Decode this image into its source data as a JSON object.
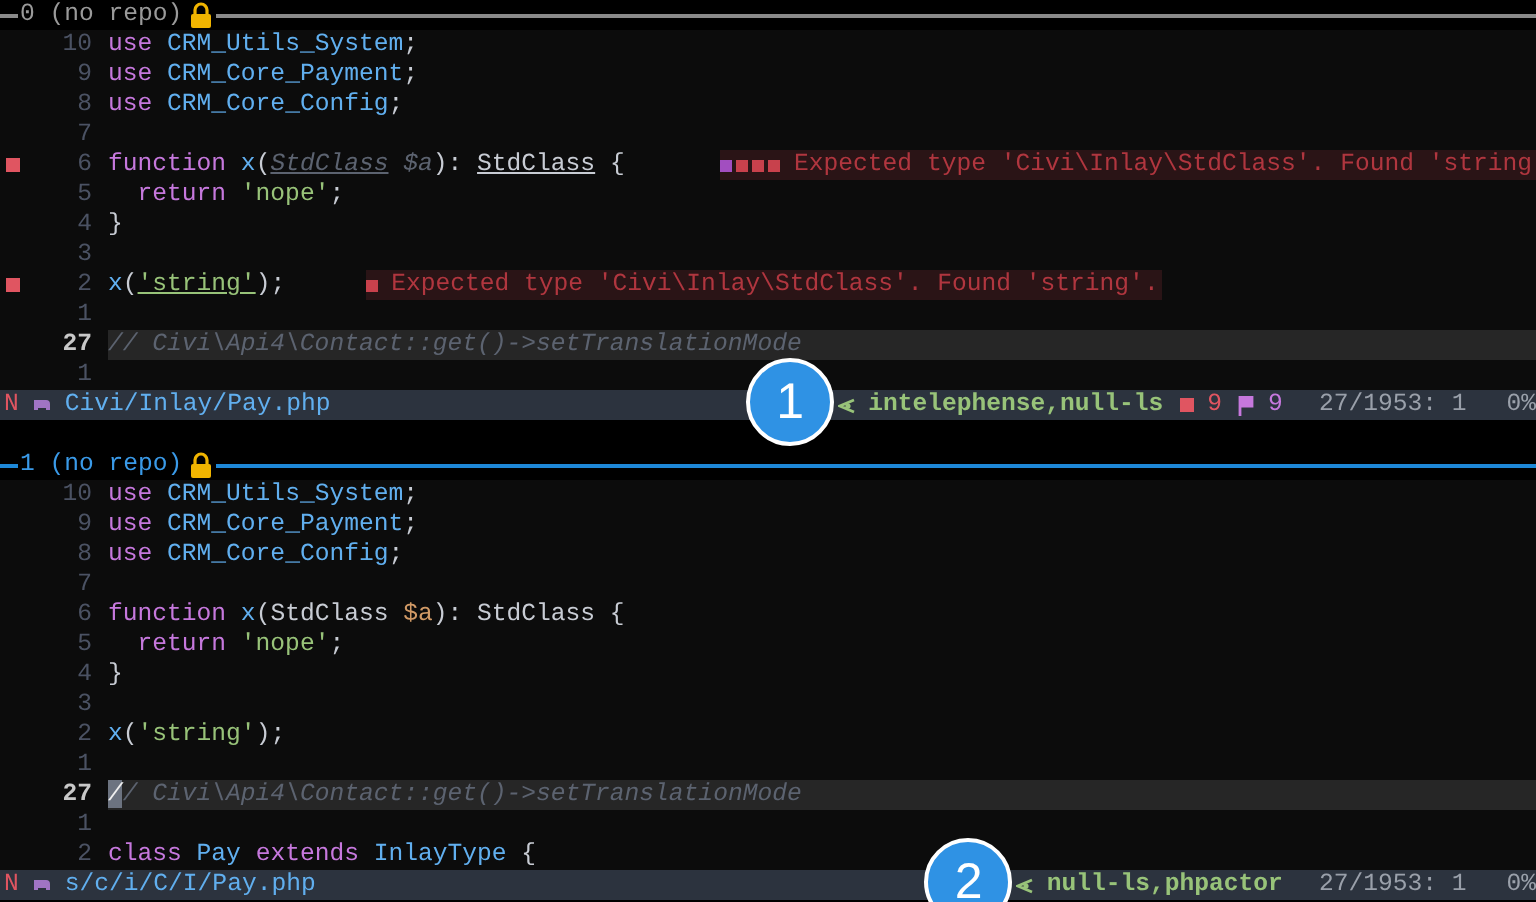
{
  "panes": [
    {
      "header": {
        "title": "0 (no repo)",
        "active": false
      },
      "lines": [
        {
          "number": "10",
          "current": false,
          "sign": false,
          "cursor": false,
          "tokens": [
            {
              "text": "use ",
              "kind": "keyword"
            },
            {
              "text": "CRM_Utils_System",
              "kind": "type"
            },
            {
              "text": ";",
              "kind": "plain"
            }
          ]
        },
        {
          "number": "9",
          "current": false,
          "sign": false,
          "cursor": false,
          "tokens": [
            {
              "text": "use ",
              "kind": "keyword"
            },
            {
              "text": "CRM_Core_Payment",
              "kind": "type"
            },
            {
              "text": ";",
              "kind": "plain"
            }
          ]
        },
        {
          "number": "8",
          "current": false,
          "sign": false,
          "cursor": false,
          "tokens": [
            {
              "text": "use ",
              "kind": "keyword"
            },
            {
              "text": "CRM_Core_Config",
              "kind": "type"
            },
            {
              "text": ";",
              "kind": "plain"
            }
          ]
        },
        {
          "number": "7",
          "current": false,
          "sign": false,
          "cursor": false
        },
        {
          "number": "6",
          "current": false,
          "sign": true,
          "cursor": false,
          "tokens": [
            {
              "text": "function ",
              "kind": "keyword"
            },
            {
              "text": "x",
              "kind": "type"
            },
            {
              "text": "(",
              "kind": "plain"
            },
            {
              "text": "StdClass",
              "kind": "unused-underlined"
            },
            {
              "text": " $a",
              "kind": "unused"
            },
            {
              "text": "): ",
              "kind": "plain"
            },
            {
              "text": "StdClass",
              "kind": "plain-underlined"
            },
            {
              "text": " {",
              "kind": "plain"
            }
          ],
          "diagnostic": {
            "marks": [
              {
                "color": "#a24ec0"
              },
              {
                "color": "#c8414c"
              },
              {
                "color": "#c8414c"
              },
              {
                "color": "#c8414c"
              }
            ],
            "text": "Expected type 'Civi\\Inlay\\StdClass'. Found 'string"
          }
        },
        {
          "number": "5",
          "current": false,
          "sign": false,
          "cursor": false,
          "tokens": [
            {
              "text": "  return ",
              "kind": "keyword"
            },
            {
              "text": "'nope'",
              "kind": "string"
            },
            {
              "text": ";",
              "kind": "plain"
            }
          ]
        },
        {
          "number": "4",
          "current": false,
          "sign": false,
          "cursor": false,
          "tokens": [
            {
              "text": "}",
              "kind": "plain"
            }
          ]
        },
        {
          "number": "3",
          "current": false,
          "sign": false,
          "cursor": false
        },
        {
          "number": "2",
          "current": false,
          "sign": true,
          "cursor": false,
          "tokens": [
            {
              "text": "x",
              "kind": "type"
            },
            {
              "text": "(",
              "kind": "plain"
            },
            {
              "text": "'string'",
              "kind": "string-underlined"
            },
            {
              "text": ");",
              "kind": "plain"
            }
          ],
          "diagnostic": {
            "marks": [
              {
                "color": "#c8414c"
              }
            ],
            "text": "Expected type 'Civi\\Inlay\\StdClass'. Found 'string'."
          }
        },
        {
          "number": "1",
          "current": false,
          "sign": false,
          "cursor": false
        },
        {
          "number": "27",
          "current": true,
          "sign": false,
          "cursor": false,
          "tokens": [
            {
              "text": "// Civi\\Api4\\Contact::get()->setTranslationMode",
              "kind": "comment"
            }
          ]
        },
        {
          "number": "1",
          "current": false,
          "sign": false,
          "cursor": false
        }
      ],
      "status": {
        "mode": "N",
        "file": "Civi/Inlay/Pay.php",
        "callout": "1",
        "lsp": "intelephense,null-ls",
        "errors": "9",
        "warnings": "9",
        "position": "27/1953: 1",
        "percent": "0%"
      }
    },
    {
      "header": {
        "title": "1 (no repo)",
        "active": true
      },
      "lines": [
        {
          "number": "10",
          "current": false,
          "sign": false,
          "cursor": false,
          "tokens": [
            {
              "text": "use ",
              "kind": "keyword"
            },
            {
              "text": "CRM_Utils_System",
              "kind": "type"
            },
            {
              "text": ";",
              "kind": "plain"
            }
          ]
        },
        {
          "number": "9",
          "current": false,
          "sign": false,
          "cursor": false,
          "tokens": [
            {
              "text": "use ",
              "kind": "keyword"
            },
            {
              "text": "CRM_Core_Payment",
              "kind": "type"
            },
            {
              "text": ";",
              "kind": "plain"
            }
          ]
        },
        {
          "number": "8",
          "current": false,
          "sign": false,
          "cursor": false,
          "tokens": [
            {
              "text": "use ",
              "kind": "keyword"
            },
            {
              "text": "CRM_Core_Config",
              "kind": "type"
            },
            {
              "text": ";",
              "kind": "plain"
            }
          ]
        },
        {
          "number": "7",
          "current": false,
          "sign": false,
          "cursor": false
        },
        {
          "number": "6",
          "current": false,
          "sign": false,
          "cursor": false,
          "tokens": [
            {
              "text": "function ",
              "kind": "keyword"
            },
            {
              "text": "x",
              "kind": "type"
            },
            {
              "text": "(StdClass ",
              "kind": "plain"
            },
            {
              "text": "$a",
              "kind": "variable"
            },
            {
              "text": "): StdClass {",
              "kind": "plain"
            }
          ]
        },
        {
          "number": "5",
          "current": false,
          "sign": false,
          "cursor": false,
          "tokens": [
            {
              "text": "  return ",
              "kind": "keyword"
            },
            {
              "text": "'nope'",
              "kind": "string"
            },
            {
              "text": ";",
              "kind": "plain"
            }
          ]
        },
        {
          "number": "4",
          "current": false,
          "sign": false,
          "cursor": false,
          "tokens": [
            {
              "text": "}",
              "kind": "plain"
            }
          ]
        },
        {
          "number": "3",
          "current": false,
          "sign": false,
          "cursor": false
        },
        {
          "number": "2",
          "current": false,
          "sign": false,
          "cursor": false,
          "tokens": [
            {
              "text": "x",
              "kind": "type"
            },
            {
              "text": "(",
              "kind": "plain"
            },
            {
              "text": "'string'",
              "kind": "string"
            },
            {
              "text": ");",
              "kind": "plain"
            }
          ]
        },
        {
          "number": "1",
          "current": false,
          "sign": false,
          "cursor": false
        },
        {
          "number": "27",
          "current": true,
          "sign": false,
          "cursor": true,
          "tokens": [
            {
              "text": "// Civi\\Api4\\Contact::get()->setTranslationMode",
              "kind": "comment"
            }
          ]
        },
        {
          "number": "1",
          "current": false,
          "sign": false,
          "cursor": false
        },
        {
          "number": "2",
          "current": false,
          "sign": false,
          "cursor": false,
          "tokens": [
            {
              "text": "class ",
              "kind": "keyword"
            },
            {
              "text": "Pay ",
              "kind": "type"
            },
            {
              "text": "extends ",
              "kind": "keyword"
            },
            {
              "text": "InlayType",
              "kind": "type"
            },
            {
              "text": " {",
              "kind": "plain"
            }
          ]
        }
      ],
      "status": {
        "mode": "N",
        "file": "s/c/i/C/I/Pay.php",
        "callout": "2",
        "lsp": "null-ls,phpactor",
        "position": "27/1953: 1",
        "percent": "0%"
      }
    }
  ]
}
